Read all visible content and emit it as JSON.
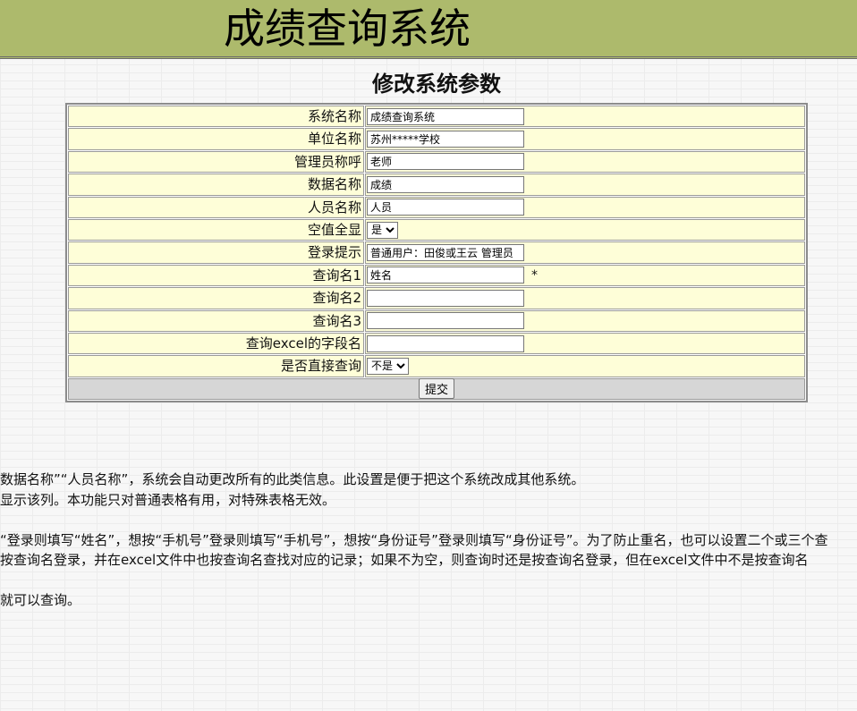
{
  "app": {
    "title": "成绩查询系统"
  },
  "page": {
    "title": "修改系统参数"
  },
  "form": {
    "rows": [
      {
        "label": "系统名称",
        "type": "text",
        "value": "成绩查询系统"
      },
      {
        "label": "单位名称",
        "type": "text",
        "value": "苏州*****学校"
      },
      {
        "label": "管理员称呼",
        "type": "text",
        "value": "老师"
      },
      {
        "label": "数据名称",
        "type": "text",
        "value": "成绩"
      },
      {
        "label": "人员名称",
        "type": "text",
        "value": "人员"
      },
      {
        "label": "空值全显",
        "type": "select",
        "value": "是"
      },
      {
        "label": "登录提示",
        "type": "text",
        "value": "普通用户：田俊或王云 管理员"
      },
      {
        "label": "查询名1",
        "type": "text",
        "value": "姓名",
        "marker": "*"
      },
      {
        "label": "查询名2",
        "type": "text",
        "value": ""
      },
      {
        "label": "查询名3",
        "type": "text",
        "value": ""
      },
      {
        "label": "查询excel的字段名",
        "type": "text",
        "value": ""
      },
      {
        "label": "是否直接查询",
        "type": "select",
        "value": "不是"
      }
    ],
    "submit_label": "提交"
  },
  "notes": [
    "数据名称”“人员名称”，系统会自动更改所有的此类信息。此设置是便于把这个系统改成其他系统。",
    "显示该列。本功能只对普通表格有用，对特殊表格无效。",
    "",
    "“登录则填写“姓名”，想按“手机号”登录则填写“手机号”，想按“身份证号”登录则填写“身份证号”。为了防止重名，也可以设置二个或三个查",
    "按查询名登录，并在excel文件中也按查询名查找对应的记录；如果不为空，则查询时还是按查询名登录，但在excel文件中不是按查询名",
    "",
    "就可以查询。"
  ]
}
